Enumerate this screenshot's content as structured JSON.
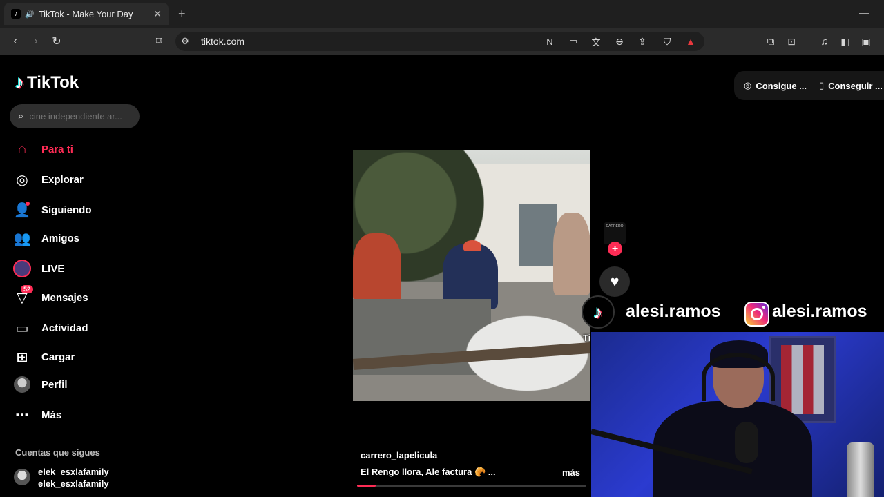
{
  "browser": {
    "tab_title": "TikTok - Make Your Day",
    "url": "tiktok.com"
  },
  "sidebar": {
    "logo": "TikTok",
    "search_placeholder": "cine independiente ar...",
    "nav": [
      {
        "label": "Para ti",
        "icon": "home-icon",
        "active": true
      },
      {
        "label": "Explorar",
        "icon": "compass-icon"
      },
      {
        "label": "Siguiendo",
        "icon": "following-icon"
      },
      {
        "label": "Amigos",
        "icon": "friends-icon"
      },
      {
        "label": "LIVE",
        "icon": "live-icon"
      },
      {
        "label": "Mensajes",
        "icon": "messages-icon",
        "badge": "52"
      },
      {
        "label": "Actividad",
        "icon": "activity-icon"
      },
      {
        "label": "Cargar",
        "icon": "upload-icon"
      },
      {
        "label": "Perfil",
        "icon": "profile-icon"
      },
      {
        "label": "Más",
        "icon": "more-icon"
      }
    ],
    "following_title": "Cuentas que sigues",
    "following": [
      {
        "name": "elek_esxlafamily",
        "handle": "elek_esxlafamily"
      }
    ]
  },
  "top_actions": {
    "coins": "Consigue ...",
    "app": "Conseguir ..."
  },
  "video": {
    "creator_avatar_text": "CARRERO",
    "username": "carrero_lapelicula",
    "caption": "El Rengo llora, Ale factura 🥐 ...",
    "more": "más",
    "progress": 0.08
  },
  "overlay": {
    "tiktok_label": "TikTok",
    "handle_tiktok": "alesi.ramos",
    "handle_instagram": "alesi.ramos"
  },
  "colors": {
    "accent": "#fe2c55",
    "cyan": "#25f4ee",
    "background": "#000000"
  }
}
